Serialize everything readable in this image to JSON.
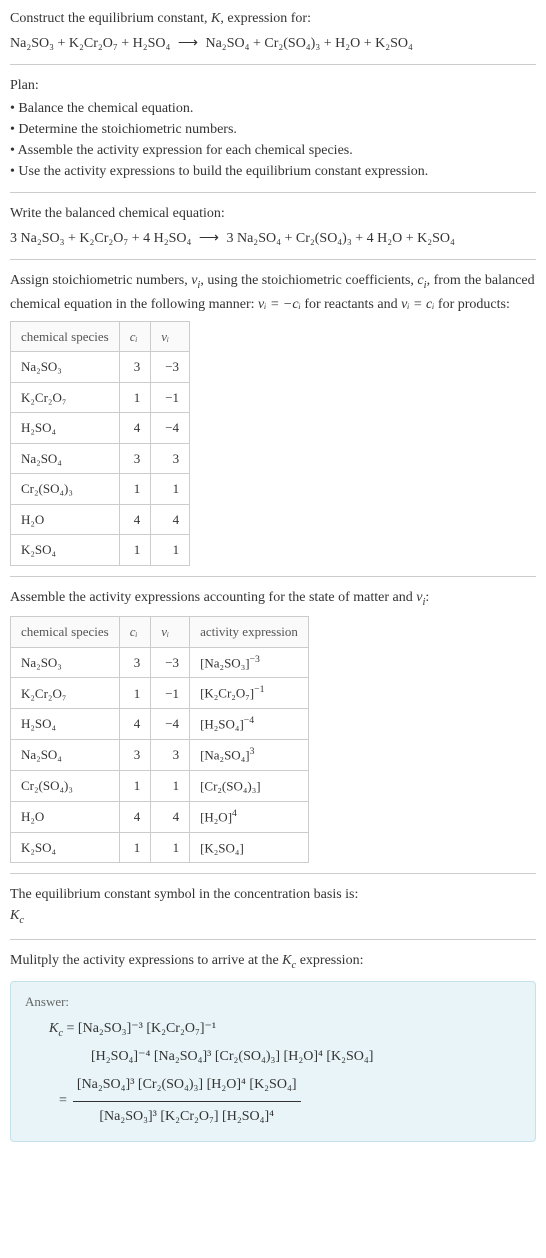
{
  "intro": {
    "line1_pre": "Construct the equilibrium constant, ",
    "line1_k": "K",
    "line1_post": ", expression for:",
    "eq_lhs": "Na₂SO₃ + K₂Cr₂O₇ + H₂SO₄",
    "arrow": "⟶",
    "eq_rhs": "Na₂SO₄ + Cr₂(SO₄)₃ + H₂O + K₂SO₄"
  },
  "plan": {
    "title": "Plan:",
    "items": [
      "Balance the chemical equation.",
      "Determine the stoichiometric numbers.",
      "Assemble the activity expression for each chemical species.",
      "Use the activity expressions to build the equilibrium constant expression."
    ]
  },
  "balanced": {
    "title": "Write the balanced chemical equation:",
    "lhs": "3 Na₂SO₃ + K₂Cr₂O₇ + 4 H₂SO₄",
    "arrow": "⟶",
    "rhs": "3 Na₂SO₄ + Cr₂(SO₄)₃ + 4 H₂O + K₂SO₄"
  },
  "assign": {
    "p1": "Assign stoichiometric numbers, ",
    "nu_i": "ν",
    "nu_sub": "i",
    "p2": ", using the stoichiometric coefficients, ",
    "c_i": "c",
    "c_sub": "i",
    "p3": ", from the balanced chemical equation in the following manner: ",
    "rel1": "νᵢ = −cᵢ",
    "p4": " for reactants and ",
    "rel2": "νᵢ = cᵢ",
    "p5": " for products:"
  },
  "table1": {
    "h1": "chemical species",
    "h2": "cᵢ",
    "h3": "νᵢ",
    "rows": [
      {
        "sp": "Na₂SO₃",
        "c": "3",
        "v": "−3"
      },
      {
        "sp": "K₂Cr₂O₇",
        "c": "1",
        "v": "−1"
      },
      {
        "sp": "H₂SO₄",
        "c": "4",
        "v": "−4"
      },
      {
        "sp": "Na₂SO₄",
        "c": "3",
        "v": "3"
      },
      {
        "sp": "Cr₂(SO₄)₃",
        "c": "1",
        "v": "1"
      },
      {
        "sp": "H₂O",
        "c": "4",
        "v": "4"
      },
      {
        "sp": "K₂SO₄",
        "c": "1",
        "v": "1"
      }
    ]
  },
  "assemble": {
    "p1": "Assemble the activity expressions accounting for the state of matter and ",
    "nu": "ν",
    "nu_sub": "i",
    "p2": ":"
  },
  "table2": {
    "h1": "chemical species",
    "h2": "cᵢ",
    "h3": "νᵢ",
    "h4": "activity expression",
    "rows": [
      {
        "sp": "Na₂SO₃",
        "c": "3",
        "v": "−3",
        "ae_base": "[Na₂SO₃]",
        "ae_exp": "−3"
      },
      {
        "sp": "K₂Cr₂O₇",
        "c": "1",
        "v": "−1",
        "ae_base": "[K₂Cr₂O₇]",
        "ae_exp": "−1"
      },
      {
        "sp": "H₂SO₄",
        "c": "4",
        "v": "−4",
        "ae_base": "[H₂SO₄]",
        "ae_exp": "−4"
      },
      {
        "sp": "Na₂SO₄",
        "c": "3",
        "v": "3",
        "ae_base": "[Na₂SO₄]",
        "ae_exp": "3"
      },
      {
        "sp": "Cr₂(SO₄)₃",
        "c": "1",
        "v": "1",
        "ae_base": "[Cr₂(SO₄)₃]",
        "ae_exp": ""
      },
      {
        "sp": "H₂O",
        "c": "4",
        "v": "4",
        "ae_base": "[H₂O]",
        "ae_exp": "4"
      },
      {
        "sp": "K₂SO₄",
        "c": "1",
        "v": "1",
        "ae_base": "[K₂SO₄]",
        "ae_exp": ""
      }
    ]
  },
  "symbol": {
    "line1": "The equilibrium constant symbol in the concentration basis is:",
    "kc": "K",
    "kc_sub": "c"
  },
  "multiply": {
    "p1": "Mulitply the activity expressions to arrive at the ",
    "kc": "K",
    "kc_sub": "c",
    "p2": " expression:"
  },
  "answer": {
    "label": "Answer:",
    "kc": "K",
    "kc_sub": "c",
    "eq": " = ",
    "line1": "[Na₂SO₃]⁻³ [K₂Cr₂O₇]⁻¹",
    "line2": "[H₂SO₄]⁻⁴ [Na₂SO₄]³ [Cr₂(SO₄)₃] [H₂O]⁴ [K₂SO₄]",
    "frac_num": "[Na₂SO₄]³ [Cr₂(SO₄)₃] [H₂O]⁴ [K₂SO₄]",
    "frac_den": "[Na₂SO₃]³ [K₂Cr₂O₇] [H₂SO₄]⁴"
  }
}
